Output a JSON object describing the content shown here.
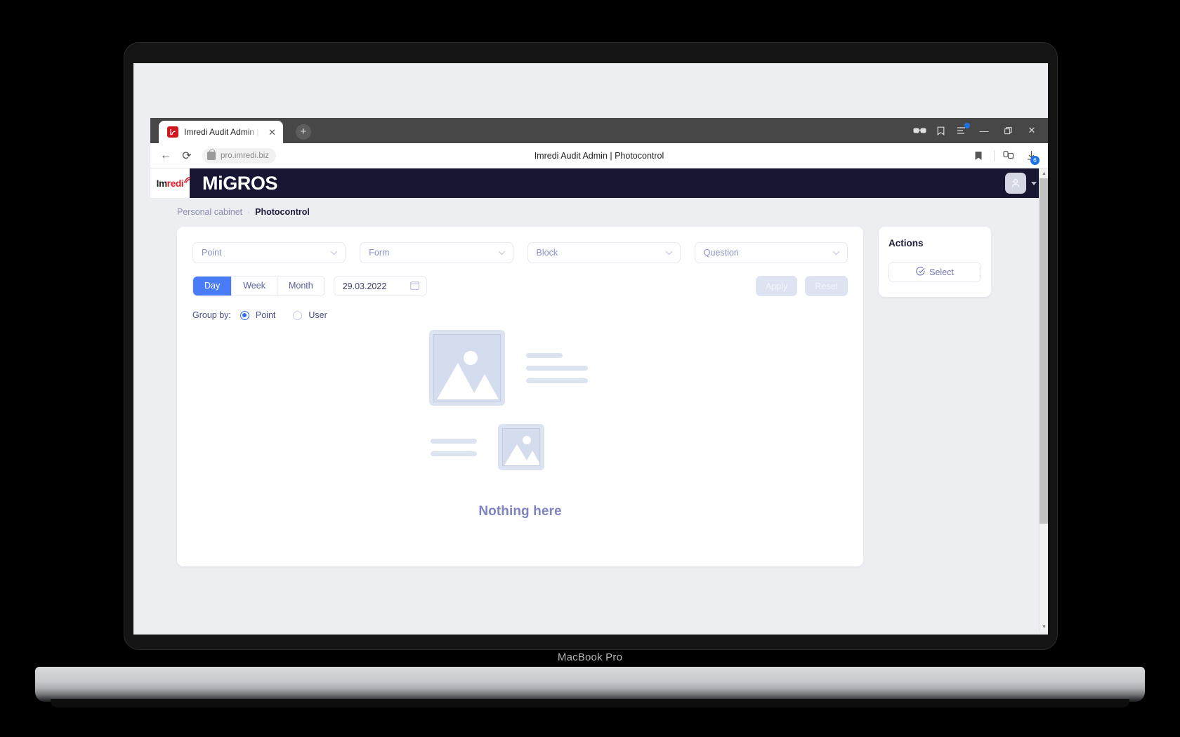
{
  "device": {
    "brand": "MacBook Pro"
  },
  "browser": {
    "tab": {
      "title": "Imredi Audit Admin | Ph",
      "close_label": "✕",
      "favicon_name": "imredi-favicon"
    },
    "new_tab_label": "+",
    "toolbar": {
      "back_label": "←",
      "reload_label": "⟳",
      "url": "pro.imredi.biz",
      "page_title": "Imredi Audit Admin | Photocontrol",
      "download_badge": "6"
    },
    "window_controls": {
      "minimize": "—",
      "maximize": "❐",
      "close": "✕"
    }
  },
  "app": {
    "logo": {
      "im": "Im",
      "redi": "redi"
    },
    "brand": "MiGROS",
    "breadcrumb": {
      "parent": "Personal cabinet",
      "separator": "·",
      "current": "Photocontrol"
    },
    "filters": [
      {
        "label": "Point",
        "name": "point-select"
      },
      {
        "label": "Form",
        "name": "form-select"
      },
      {
        "label": "Block",
        "name": "block-select"
      },
      {
        "label": "Question",
        "name": "question-select"
      }
    ],
    "period": {
      "options": [
        "Day",
        "Week",
        "Month"
      ],
      "selected": "Day",
      "date_value": "29.03.2022"
    },
    "actions_buttons": {
      "apply": "Apply",
      "reset": "Reset"
    },
    "group_by": {
      "label": "Group by:",
      "options": [
        "Point",
        "User"
      ],
      "selected": "Point"
    },
    "empty_state": {
      "text": "Nothing here"
    },
    "actions_panel": {
      "title": "Actions",
      "select_label": "Select"
    },
    "colors": {
      "header_bg": "#171733",
      "accent_blue": "#4a7cf7",
      "brand_red": "#e2202b",
      "placeholder_blue": "#dbe2f0",
      "muted_text": "#8b8fc4"
    }
  }
}
